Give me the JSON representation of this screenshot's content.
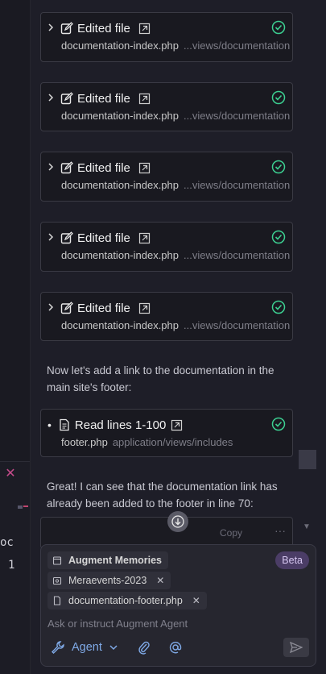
{
  "left": {
    "close": "✕",
    "text": "oc",
    "number": "1"
  },
  "edit_cards": [
    {
      "title": "Edited file",
      "file": "documentation-index.php",
      "path": "...views/documentation"
    },
    {
      "title": "Edited file",
      "file": "documentation-index.php",
      "path": "...views/documentation"
    },
    {
      "title": "Edited file",
      "file": "documentation-index.php",
      "path": "...views/documentation"
    },
    {
      "title": "Edited file",
      "file": "documentation-index.php",
      "path": "...views/documentation"
    },
    {
      "title": "Edited file",
      "file": "documentation-index.php",
      "path": "...views/documentation"
    }
  ],
  "message1": "Now let's add a link to the documentation in the main site's footer:",
  "read_card": {
    "bullet": "•",
    "title": "Read lines 1-100",
    "file": "footer.php",
    "path": "application/views/includes"
  },
  "message2": "Great! I can see that the documentation link has already been added to the footer in line 70:",
  "partial_card": {
    "copy": "Copy",
    "more": "···"
  },
  "input": {
    "chips": [
      {
        "label": "Augment Memories",
        "closable": false
      },
      {
        "label": "Meraevents-2023",
        "closable": true
      },
      {
        "label": "documentation-footer.php",
        "closable": true
      }
    ],
    "chip_close": "✕",
    "beta": "Beta",
    "placeholder": "Ask or instruct Augment Agent",
    "agent_label": "Agent"
  },
  "colors": {
    "accent": "#7fa9e6",
    "success": "#3ccf91",
    "beta_bg": "#4b3d66"
  }
}
